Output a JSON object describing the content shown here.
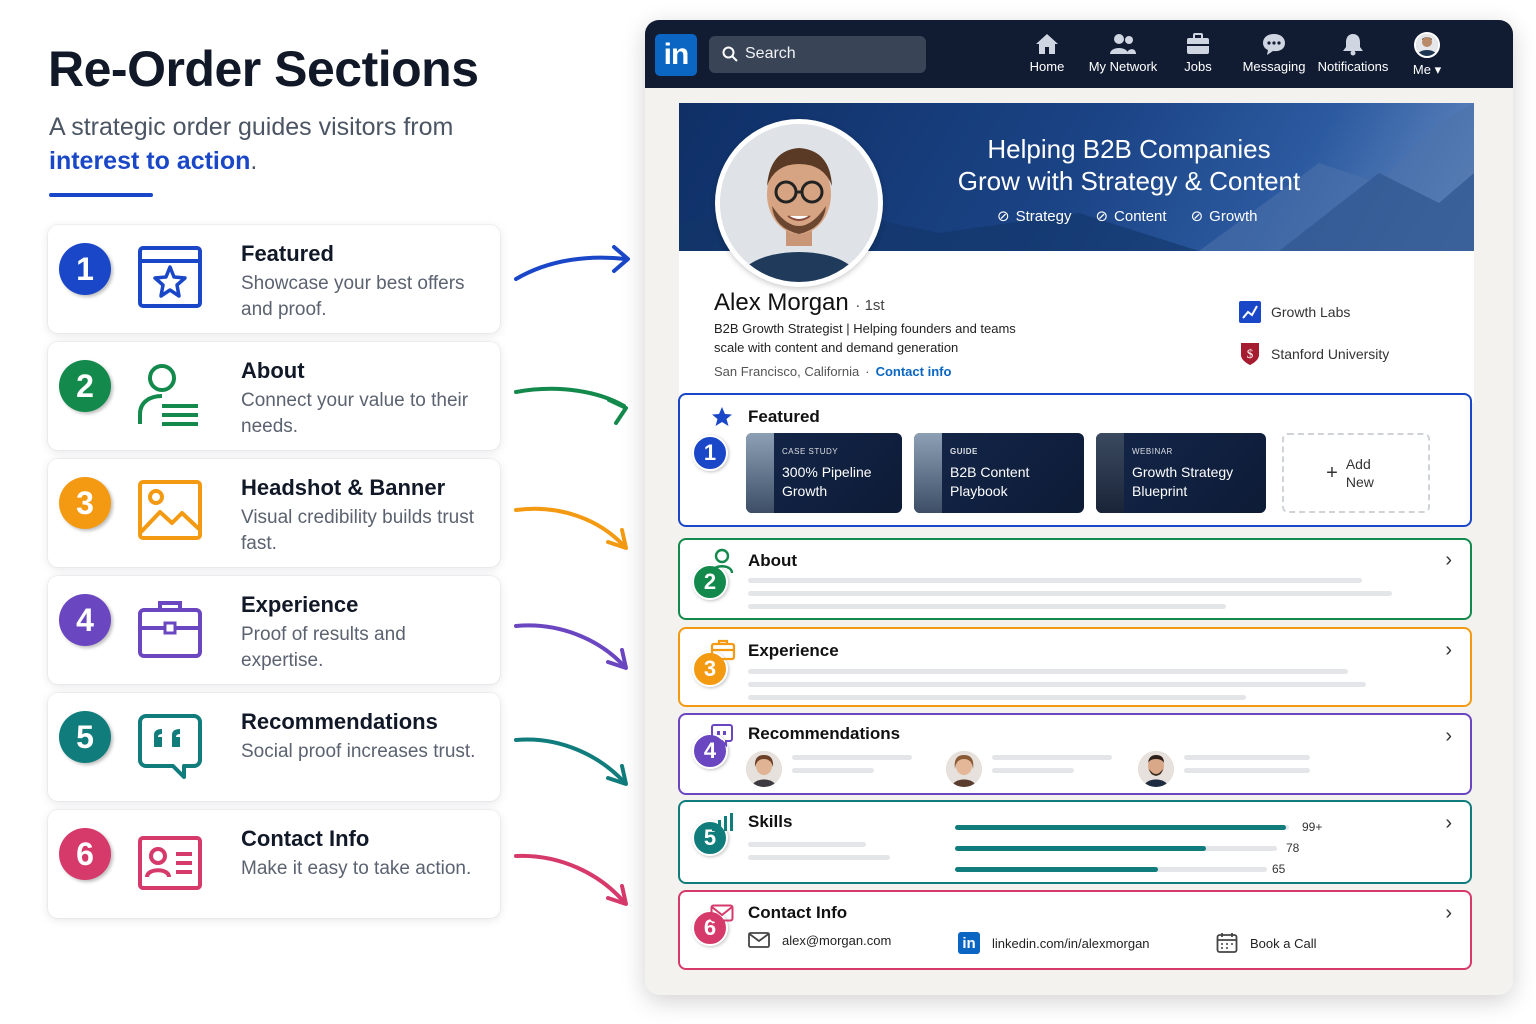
{
  "hero": {
    "title": "Re-Order Sections",
    "subtitle_pre": "A strategic order guides visitors from ",
    "subtitle_accent": "interest to action",
    "subtitle_post": "."
  },
  "steps": [
    {
      "num": "1",
      "title": "Featured",
      "desc": "Showcase your best offers and proof.",
      "color": "#1a47c7",
      "icon": "star-card-icon"
    },
    {
      "num": "2",
      "title": "About",
      "desc": "Connect your value to their needs.",
      "color": "#138a4c",
      "icon": "person-lines-icon"
    },
    {
      "num": "3",
      "title": "Headshot & Banner",
      "desc": "Visual credibility builds trust fast.",
      "color": "#f39a12",
      "icon": "image-icon"
    },
    {
      "num": "4",
      "title": "Experience",
      "desc": "Proof of results and expertise.",
      "color": "#6b46c1",
      "icon": "briefcase-icon"
    },
    {
      "num": "5",
      "title": "Recommendations",
      "desc": "Social proof increases trust.",
      "color": "#117c7c",
      "icon": "quote-bubble-icon"
    },
    {
      "num": "6",
      "title": "Contact Info",
      "desc": "Make it easy to take action.",
      "color": "#d63a6a",
      "icon": "contact-card-icon"
    }
  ],
  "topbar": {
    "logo": "in",
    "search_placeholder": "Search",
    "nav": [
      {
        "label": "Home",
        "icon": "home-icon"
      },
      {
        "label": "My Network",
        "icon": "network-icon"
      },
      {
        "label": "Jobs",
        "icon": "jobs-icon"
      },
      {
        "label": "Messaging",
        "icon": "messaging-icon"
      },
      {
        "label": "Notifications",
        "icon": "bell-icon"
      },
      {
        "label": "Me",
        "icon": "avatar"
      }
    ]
  },
  "profile": {
    "banner_line1": "Helping B2B Companies",
    "banner_line2": "Grow with Strategy & Content",
    "tags": [
      "Strategy",
      "Content",
      "Growth"
    ],
    "name": "Alex Morgan",
    "degree": "· 1st",
    "headline": "B2B Growth Strategist | Helping founders and teams scale with content and demand generation",
    "location": "San Francisco, California",
    "contact_link": "Contact info",
    "orgs": [
      "Growth Labs",
      "Stanford University"
    ]
  },
  "featured": {
    "num": "1",
    "title": "Featured",
    "items": [
      {
        "kicker": "CASE STUDY",
        "name": "300% Pipeline Growth"
      },
      {
        "kicker": "GUIDE",
        "name": "B2B Content Playbook"
      },
      {
        "kicker": "WEBINAR",
        "name": "Growth Strategy Blueprint"
      }
    ],
    "add_label": "Add New"
  },
  "about": {
    "num": "2",
    "title": "About"
  },
  "experience": {
    "num": "3",
    "title": "Experience"
  },
  "recommendations": {
    "num": "4",
    "title": "Recommendations"
  },
  "skills": {
    "num": "5",
    "title": "Skills",
    "bars": [
      {
        "count": "99+",
        "level": 0.99
      },
      {
        "count": "78",
        "level": 0.78
      },
      {
        "count": "65",
        "level": 0.65
      }
    ]
  },
  "contact": {
    "num": "6",
    "title": "Contact Info",
    "email": "alex@morgan.com",
    "linkedin": "linkedin.com/in/alexmorgan",
    "book": "Book a Call"
  },
  "colors": {
    "blue": "#1a47c7",
    "green": "#138a4c",
    "orange": "#f39a12",
    "purple": "#6b46c1",
    "teal": "#117c7c",
    "pink": "#d63a6a",
    "navy": "#111c33",
    "linkedin": "#0a66c2"
  }
}
